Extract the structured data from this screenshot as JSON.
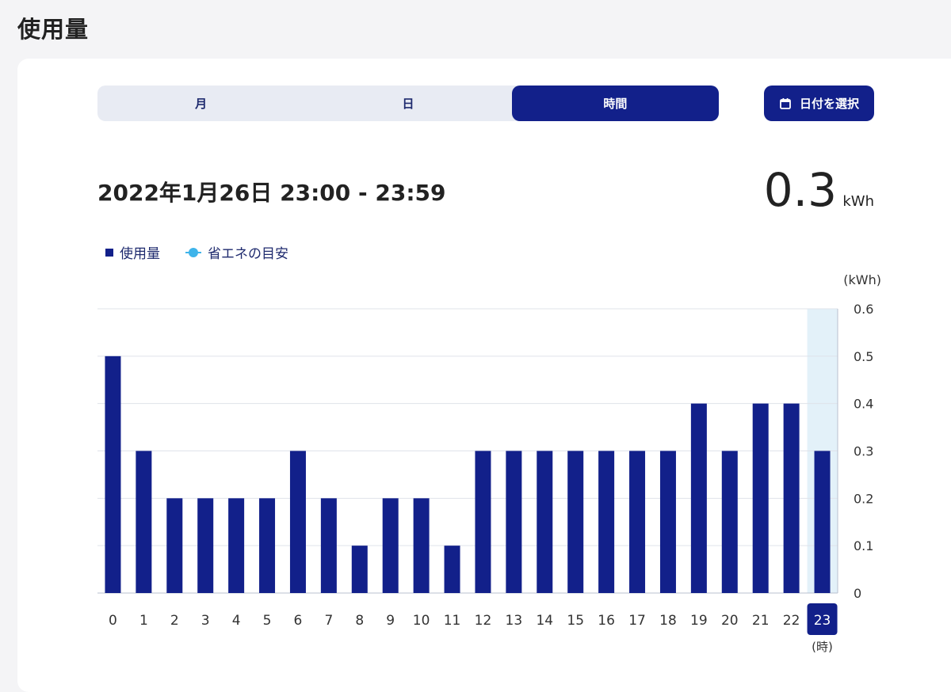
{
  "page": {
    "title": "使用量"
  },
  "tabs": [
    {
      "label": "月",
      "active": false
    },
    {
      "label": "日",
      "active": false
    },
    {
      "label": "時間",
      "active": true
    }
  ],
  "date_button": {
    "label": "日付を選択",
    "icon": "calendar-icon"
  },
  "summary": {
    "range": "2022年1月26日 23:00 - 23:59",
    "value": "0.3",
    "unit": "kWh"
  },
  "legend": {
    "usage": "使用量",
    "target": "省エネの目安"
  },
  "colors": {
    "accent": "#12208a",
    "target": "#3fb4ea",
    "highlight": "#e3f1f9"
  },
  "chart_data": {
    "type": "bar",
    "categories": [
      "0",
      "1",
      "2",
      "3",
      "4",
      "5",
      "6",
      "7",
      "8",
      "9",
      "10",
      "11",
      "12",
      "13",
      "14",
      "15",
      "16",
      "17",
      "18",
      "19",
      "20",
      "21",
      "22",
      "23"
    ],
    "series": [
      {
        "name": "使用量",
        "values": [
          0.5,
          0.3,
          0.2,
          0.2,
          0.2,
          0.2,
          0.3,
          0.2,
          0.1,
          0.2,
          0.2,
          0.1,
          0.3,
          0.3,
          0.3,
          0.3,
          0.3,
          0.3,
          0.3,
          0.4,
          0.3,
          0.4,
          0.4,
          0.3
        ]
      }
    ],
    "ylim": [
      0,
      0.6
    ],
    "yticks": [
      "0",
      "0.1",
      "0.2",
      "0.3",
      "0.4",
      "0.5",
      "0.6"
    ],
    "yunit": "(kWh)",
    "xunit": "(時)",
    "selected_index": 23,
    "grid": true,
    "y_axis_position": "right"
  }
}
